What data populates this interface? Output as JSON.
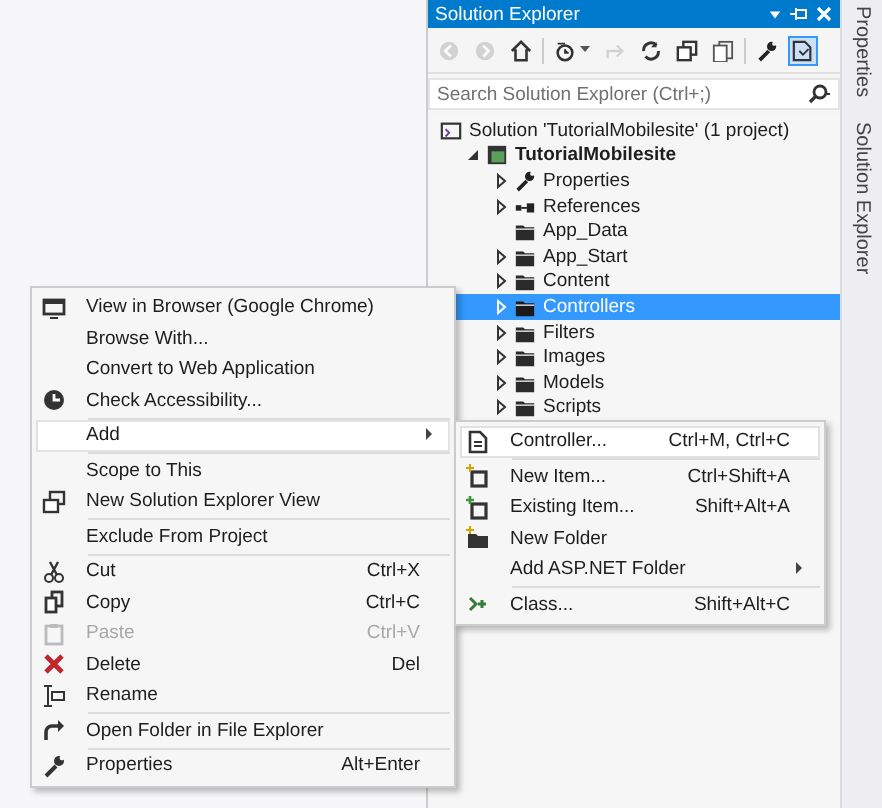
{
  "solution_explorer": {
    "title": "Solution Explorer",
    "toolbar": [
      {
        "selected": false,
        "disabled": true
      },
      {
        "selected": false,
        "disabled": true
      },
      {
        "selected": false,
        "disabled": false
      },
      {
        "selected": false,
        "disabled": false
      },
      {
        "selected": false,
        "disabled": true
      },
      {
        "selected": false,
        "disabled": false
      },
      {
        "selected": false,
        "disabled": false
      },
      {
        "selected": false,
        "disabled": false
      },
      {
        "selected": false,
        "disabled": false
      },
      {
        "selected": true,
        "disabled": false
      }
    ],
    "search": {
      "placeholder": "Search Solution Explorer (Ctrl+;)"
    },
    "tree": [
      {
        "label": "Solution 'TutorialMobilesite' (1 project)",
        "kind": "solution",
        "selected": false,
        "children": [
          {
            "label": "TutorialMobilesite",
            "kind": "project",
            "expanded": true,
            "selected": false,
            "children": [
              {
                "label": "Properties",
                "kind": "properties",
                "expanded": false,
                "selected": false
              },
              {
                "label": "References",
                "kind": "references",
                "expanded": false,
                "selected": false
              },
              {
                "label": "App_Data",
                "kind": "folder",
                "selected": false
              },
              {
                "label": "App_Start",
                "kind": "folder",
                "expanded": false,
                "selected": false
              },
              {
                "label": "Content",
                "kind": "folder",
                "expanded": false,
                "selected": false
              },
              {
                "label": "Controllers",
                "kind": "folder",
                "expanded": false,
                "selected": true
              },
              {
                "label": "Filters",
                "kind": "folder",
                "expanded": false,
                "selected": false
              },
              {
                "label": "Images",
                "kind": "folder",
                "expanded": false,
                "selected": false
              },
              {
                "label": "Models",
                "kind": "folder",
                "expanded": false,
                "selected": false
              },
              {
                "label": "Scripts",
                "kind": "folder",
                "expanded": false,
                "selected": false
              }
            ]
          }
        ]
      }
    ]
  },
  "side_tabs": [
    {
      "label": "Properties"
    },
    {
      "label": "Solution Explorer"
    }
  ],
  "context_menu": {
    "items": [
      {
        "kind": "item",
        "label": "View in Browser (Google Chrome)",
        "selected": false,
        "disabled": false
      },
      {
        "kind": "item",
        "label": "Browse With...",
        "selected": false,
        "disabled": false
      },
      {
        "kind": "item",
        "label": "Convert to Web Application",
        "selected": false,
        "disabled": false
      },
      {
        "kind": "item",
        "label": "Check Accessibility...",
        "selected": false,
        "disabled": false
      },
      {
        "kind": "separator"
      },
      {
        "kind": "item",
        "label": "Add",
        "submenu": true,
        "selected": true,
        "disabled": false
      },
      {
        "kind": "separator"
      },
      {
        "kind": "item",
        "label": "Scope to This",
        "selected": false,
        "disabled": false
      },
      {
        "kind": "item",
        "label": "New Solution Explorer View",
        "selected": false,
        "disabled": false
      },
      {
        "kind": "separator"
      },
      {
        "kind": "item",
        "label": "Exclude From Project",
        "selected": false,
        "disabled": false
      },
      {
        "kind": "separator"
      },
      {
        "kind": "item",
        "label": "Cut",
        "shortcut": "Ctrl+X",
        "selected": false,
        "disabled": false
      },
      {
        "kind": "item",
        "label": "Copy",
        "shortcut": "Ctrl+C",
        "selected": false,
        "disabled": false
      },
      {
        "kind": "item",
        "label": "Paste",
        "shortcut": "Ctrl+V",
        "selected": false,
        "disabled": true
      },
      {
        "kind": "item",
        "label": "Delete",
        "shortcut": "Del",
        "selected": false,
        "disabled": false
      },
      {
        "kind": "item",
        "label": "Rename",
        "selected": false,
        "disabled": false
      },
      {
        "kind": "separator"
      },
      {
        "kind": "item",
        "label": "Open Folder in File Explorer",
        "selected": false,
        "disabled": false
      },
      {
        "kind": "separator"
      },
      {
        "kind": "item",
        "label": "Properties",
        "shortcut": "Alt+Enter",
        "selected": false,
        "disabled": false
      }
    ]
  },
  "add_submenu": {
    "items": [
      {
        "kind": "item",
        "label": "Controller...",
        "shortcut": "Ctrl+M, Ctrl+C",
        "selected": true,
        "disabled": false
      },
      {
        "kind": "separator"
      },
      {
        "kind": "item",
        "label": "New Item...",
        "shortcut": "Ctrl+Shift+A",
        "selected": false,
        "disabled": false
      },
      {
        "kind": "item",
        "label": "Existing Item...",
        "shortcut": "Shift+Alt+A",
        "selected": false,
        "disabled": false
      },
      {
        "kind": "item",
        "label": "New Folder",
        "selected": false,
        "disabled": false
      },
      {
        "kind": "item",
        "label": "Add ASP.NET Folder",
        "submenu": true,
        "selected": false,
        "disabled": false
      },
      {
        "kind": "separator"
      },
      {
        "kind": "item",
        "label": "Class...",
        "shortcut": "Shift+Alt+C",
        "selected": false,
        "disabled": false
      }
    ]
  }
}
